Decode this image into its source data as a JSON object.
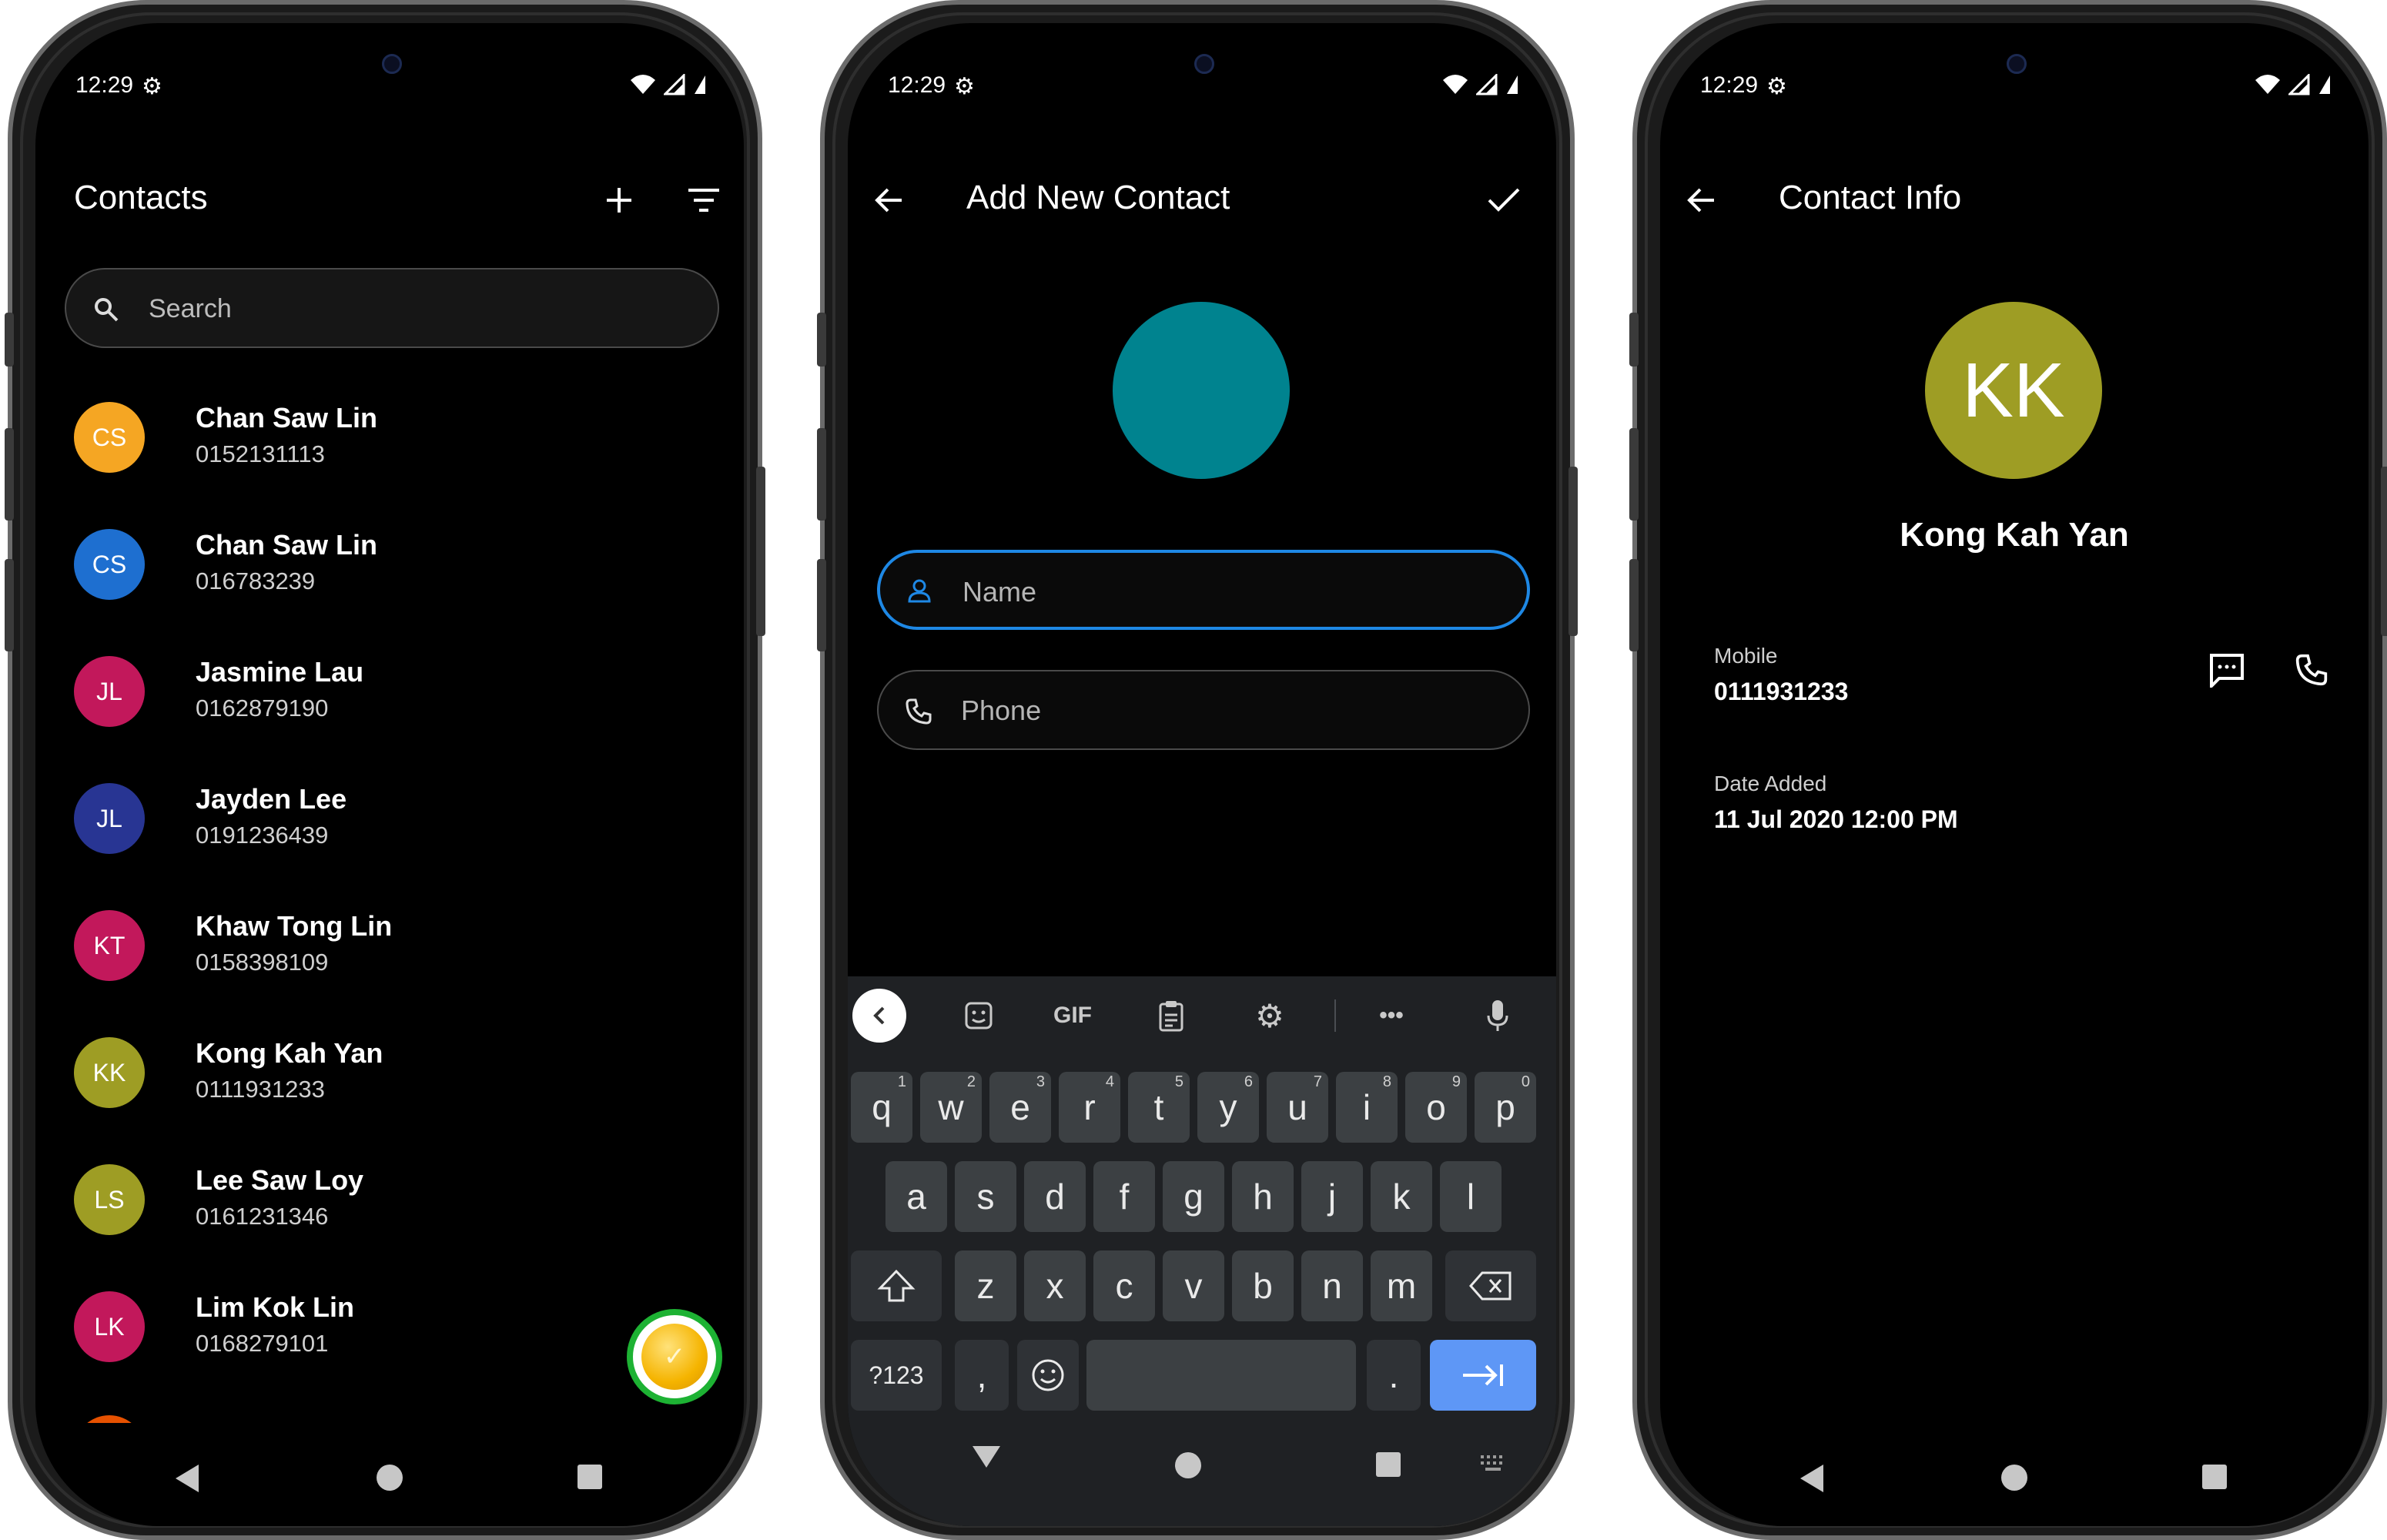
{
  "status": {
    "time": "12:29"
  },
  "colors": {
    "accent": "#1e88e5",
    "fab_ring": "#1db233",
    "fab_fill": "#f5b400"
  },
  "contacts_screen": {
    "title": "Contacts",
    "search_placeholder": "Search",
    "contacts": [
      {
        "initials": "CS",
        "name": "Chan Saw Lin",
        "phone": "0152131113",
        "color": "#f5a623"
      },
      {
        "initials": "CS",
        "name": "Chan Saw Lin",
        "phone": "016783239",
        "color": "#1e6fd0"
      },
      {
        "initials": "JL",
        "name": "Jasmine Lau",
        "phone": "0162879190",
        "color": "#c2185b"
      },
      {
        "initials": "JL",
        "name": "Jayden Lee",
        "phone": "0191236439",
        "color": "#283593"
      },
      {
        "initials": "KT",
        "name": "Khaw Tong Lin",
        "phone": "0158398109",
        "color": "#c2185b"
      },
      {
        "initials": "KK",
        "name": "Kong Kah Yan",
        "phone": "0111931233",
        "color": "#9e9d24"
      },
      {
        "initials": "LS",
        "name": "Lee Saw Loy",
        "phone": "0161231346",
        "color": "#9e9d24"
      },
      {
        "initials": "LK",
        "name": "Lim Kok Lin",
        "phone": "0168279101",
        "color": "#c2185b"
      }
    ]
  },
  "add_screen": {
    "title": "Add New Contact",
    "avatar_color": "#00838f",
    "name_placeholder": "Name",
    "phone_placeholder": "Phone",
    "keyboard": {
      "toolbar_gif": "GIF",
      "row1": [
        {
          "k": "q",
          "n": "1"
        },
        {
          "k": "w",
          "n": "2"
        },
        {
          "k": "e",
          "n": "3"
        },
        {
          "k": "r",
          "n": "4"
        },
        {
          "k": "t",
          "n": "5"
        },
        {
          "k": "y",
          "n": "6"
        },
        {
          "k": "u",
          "n": "7"
        },
        {
          "k": "i",
          "n": "8"
        },
        {
          "k": "o",
          "n": "9"
        },
        {
          "k": "p",
          "n": "0"
        }
      ],
      "row2": [
        "a",
        "s",
        "d",
        "f",
        "g",
        "h",
        "j",
        "k",
        "l"
      ],
      "row3": [
        "z",
        "x",
        "c",
        "v",
        "b",
        "n",
        "m"
      ],
      "symbols": "?123",
      "comma": ",",
      "period": "."
    }
  },
  "info_screen": {
    "title": "Contact Info",
    "initials": "KK",
    "avatar_color": "#9e9d24",
    "name": "Kong Kah Yan",
    "mobile_label": "Mobile",
    "mobile": "0111931233",
    "date_label": "Date Added",
    "date": "11 Jul 2020 12:00 PM"
  }
}
